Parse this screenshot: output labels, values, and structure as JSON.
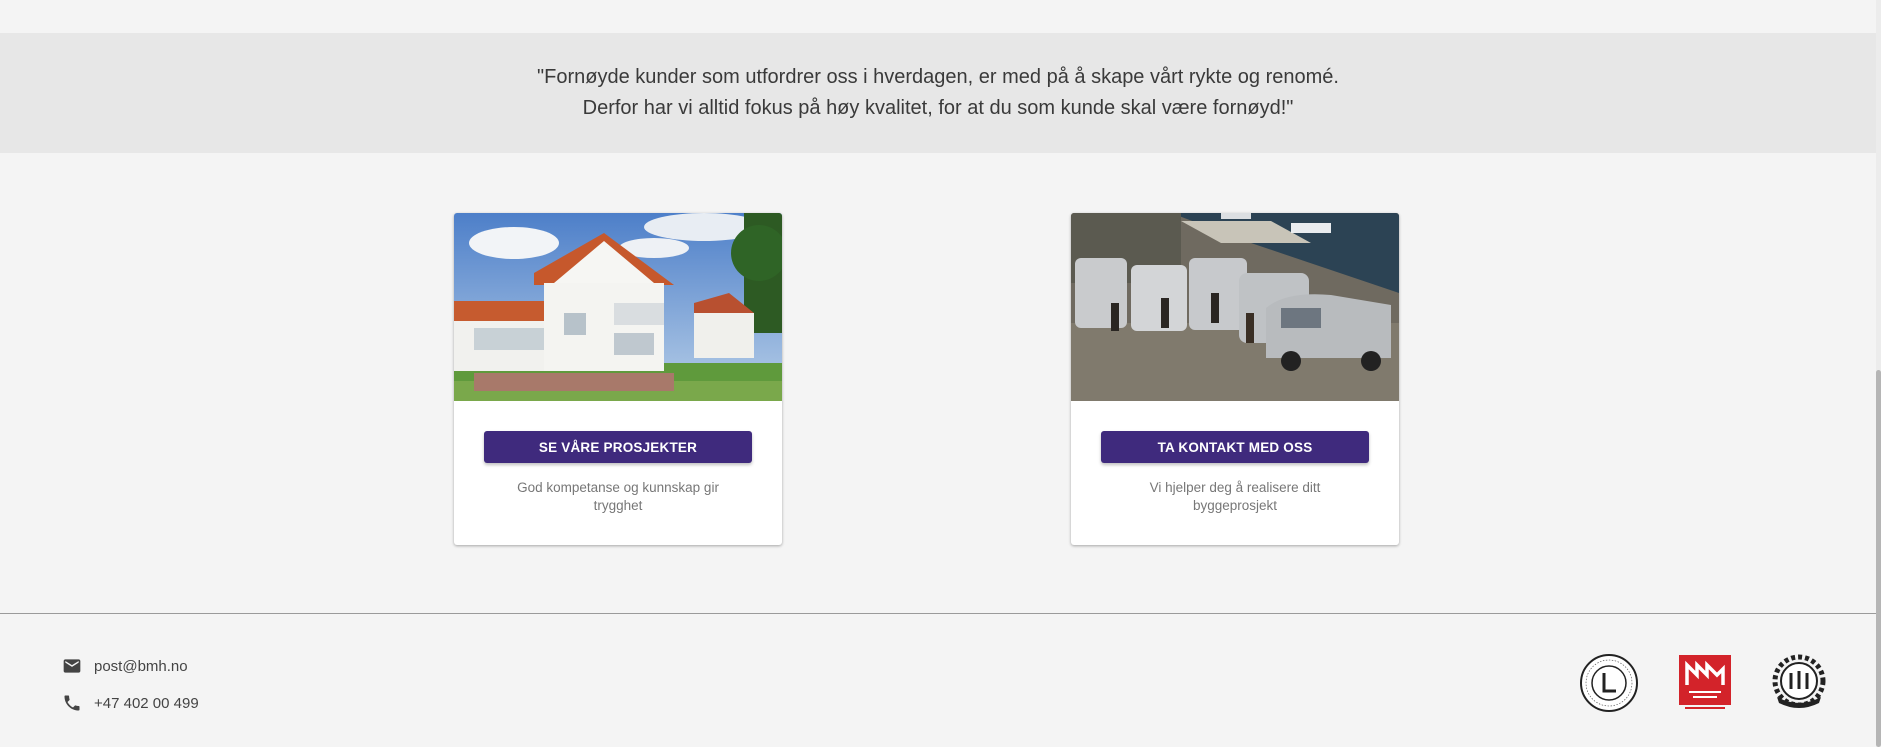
{
  "quote": {
    "line1": "\"Fornøyde kunder som utfordrer oss i hverdagen, er med på å skape vårt rykte og renomé.",
    "line2": "Derfor har vi alltid fokus på høy kvalitet, for at du som kunde skal være fornøyd!\""
  },
  "cards": [
    {
      "image_icon": "house-photo",
      "button_label": "SE VÅRE PROSJEKTER",
      "caption": "God kompetanse og kunnskap gir trygghet"
    },
    {
      "image_icon": "vans-photo",
      "button_label": "TA KONTAKT MED OSS",
      "caption": "Vi hjelper deg å realisere ditt byggeprosjekt"
    }
  ],
  "footer": {
    "email": "post@bmh.no",
    "phone": "+47 402 00 499",
    "badges": [
      "laerling-badge",
      "sentralgodkjenning-badge",
      "mester-badge"
    ]
  },
  "colors": {
    "accent": "#3f2a7d",
    "badge_red": "#d3232a"
  }
}
